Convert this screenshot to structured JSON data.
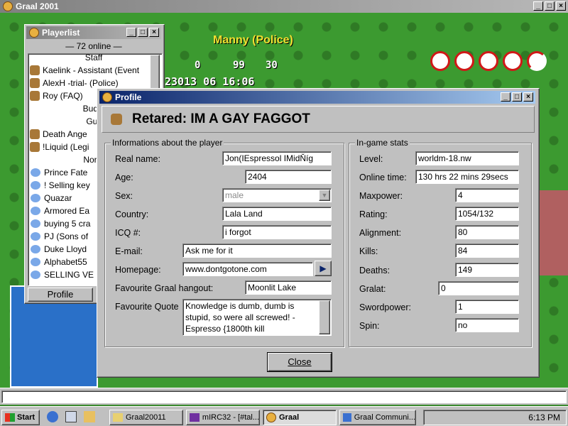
{
  "game": {
    "window_title": "Graal 2001",
    "player_name": "Manny (Police)",
    "hud_values": [
      "0",
      "99",
      "30"
    ],
    "hud_time": "23013 06 16:06"
  },
  "playerlist": {
    "title": "Playerlist",
    "online": "— 72 online —",
    "items": [
      {
        "type": "header",
        "label": "Staff"
      },
      {
        "type": "player",
        "label": "Kaelink - Assistant (Event"
      },
      {
        "type": "player",
        "label": "AlexH -trial- (Police)"
      },
      {
        "type": "player",
        "label": "Roy (FAQ)"
      },
      {
        "type": "header",
        "label": "Buddi"
      },
      {
        "type": "header",
        "label": "Guil"
      },
      {
        "type": "player",
        "label": "Death Ange"
      },
      {
        "type": "player",
        "label": "!Liquid (Legi"
      },
      {
        "type": "header",
        "label": "Norm"
      },
      {
        "type": "player",
        "label": "Prince Fate"
      },
      {
        "type": "player",
        "label": "! Selling key"
      },
      {
        "type": "player",
        "label": "Quazar"
      },
      {
        "type": "player",
        "label": "Armored Ea"
      },
      {
        "type": "player",
        "label": "buying 5 cra"
      },
      {
        "type": "player",
        "label": "PJ (Sons of"
      },
      {
        "type": "player",
        "label": "Duke Lloyd"
      },
      {
        "type": "player",
        "label": "Alphabet55"
      },
      {
        "type": "player",
        "label": "SELLING VE"
      }
    ],
    "profile_button": "Profile"
  },
  "profile": {
    "title": "Profile",
    "heading": "Retared: IM A GAY FAGGOT",
    "info_group": "Informations about the player",
    "stats_group": "In-game stats",
    "fields": {
      "real_name": {
        "label": "Real name:",
        "value": "Jon(IEspressol IMidŇíg"
      },
      "age": {
        "label": "Age:",
        "value": "2404"
      },
      "sex": {
        "label": "Sex:",
        "value": "male"
      },
      "country": {
        "label": "Country:",
        "value": "Lala Land"
      },
      "icq": {
        "label": "ICQ #:",
        "value": "i forgot"
      },
      "email": {
        "label": "E-mail:",
        "value": "Ask me for it"
      },
      "homepage": {
        "label": "Homepage:",
        "value": "www.dontgotone.com"
      },
      "hangout": {
        "label": "Favourite Graal hangout:",
        "value": "Moonlit Lake"
      },
      "quote": {
        "label": "Favourite Quote",
        "value": "Knowledge is dumb, dumb is stupid, so were all screwed! -Espresso {1800th kill"
      }
    },
    "stats": {
      "level": {
        "label": "Level:",
        "value": "worldm-18.nw"
      },
      "online_time": {
        "label": "Online time:",
        "value": "130 hrs 22 mins 29secs"
      },
      "maxpower": {
        "label": "Maxpower:",
        "value": "4"
      },
      "rating": {
        "label": "Rating:",
        "value": "1054/132"
      },
      "alignment": {
        "label": "Alignment:",
        "value": "80"
      },
      "kills": {
        "label": "Kills:",
        "value": "84"
      },
      "deaths": {
        "label": "Deaths:",
        "value": "149"
      },
      "gralat": {
        "label": "Gralat:",
        "value": "0"
      },
      "swordpower": {
        "label": "Swordpower:",
        "value": "1"
      },
      "spin": {
        "label": "Spin:",
        "value": "no"
      }
    },
    "close_button": "Close"
  },
  "taskbar": {
    "start": "Start",
    "tasks": [
      "Graal20011",
      "mIRC32 - [#tal...",
      "Graal",
      "Graal Communi..."
    ],
    "clock": "6:13 PM"
  },
  "titlebar_buttons": {
    "minimize": "_",
    "maximize": "□",
    "close": "×"
  }
}
